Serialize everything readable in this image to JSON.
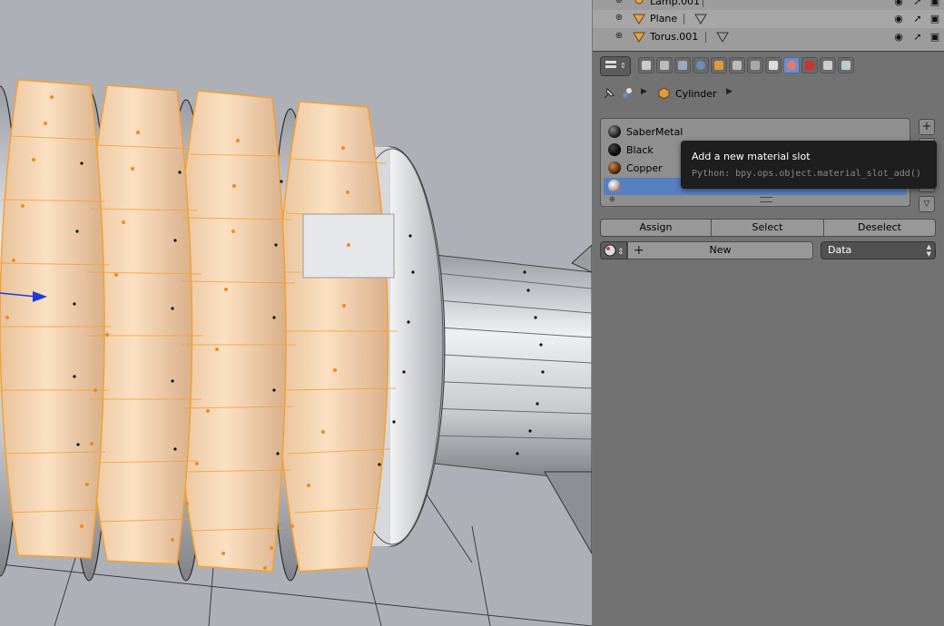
{
  "outliner": {
    "rows": [
      {
        "name": "Lamp.001",
        "type": "lamp"
      },
      {
        "name": "Plane",
        "type": "mesh"
      },
      {
        "name": "Torus.001",
        "type": "mesh"
      }
    ]
  },
  "properties": {
    "tabs": [
      "render-icon",
      "render-layers-icon",
      "scene-icon",
      "world-icon",
      "object-icon",
      "constraints-icon",
      "modifiers-icon",
      "data-icon",
      "material-icon",
      "texture-icon",
      "particles-icon",
      "physics-icon"
    ],
    "active_tab": "material-icon",
    "context": {
      "object_name": "Cylinder"
    },
    "material_slots": [
      {
        "name": "SaberMetal",
        "color": "#1a1a1a"
      },
      {
        "name": "Black",
        "color": "#0d0d0d"
      },
      {
        "name": "Copper",
        "color": "#5a3414"
      },
      {
        "name": "",
        "color": "#cfcfcf",
        "selected": true
      }
    ],
    "buttons": {
      "assign": "Assign",
      "select": "Select",
      "deselect": "Deselect",
      "new": "New"
    },
    "link_dropdown": {
      "value": "Data"
    }
  },
  "tooltip": {
    "title": "Add a new material slot",
    "python": "Python: bpy.ops.object.material_slot_add()"
  },
  "colors": {
    "selection_orange": "#f4a133",
    "face_fill": "#f2cfa6",
    "active_blue": "#5680c2"
  }
}
